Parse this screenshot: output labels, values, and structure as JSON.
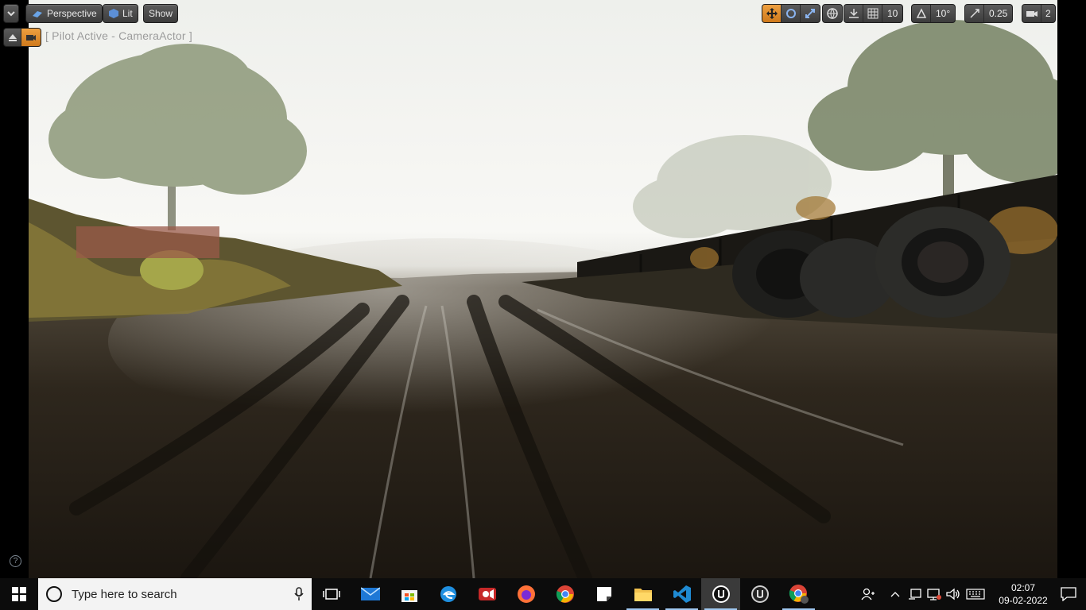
{
  "viewport": {
    "toolbar": {
      "menu_icon": "chevron-down-icon",
      "perspective_label": "Perspective",
      "lit_label": "Lit",
      "show_label": "Show",
      "grid_snap_value": "10",
      "rotation_snap_value": "10°",
      "scale_snap_value": "0.25",
      "camera_speed_value": "2",
      "active_color": "#e5952e"
    },
    "pilot_label": "[ Pilot Active - CameraActor ]",
    "help_icon": "?"
  },
  "taskbar": {
    "search_placeholder": "Type here to search",
    "apps": [
      {
        "name": "task-view-icon"
      },
      {
        "name": "mail-icon"
      },
      {
        "name": "store-icon"
      },
      {
        "name": "edge-icon"
      },
      {
        "name": "screen-recorder-icon"
      },
      {
        "name": "firefox-icon"
      },
      {
        "name": "chrome-icon"
      },
      {
        "name": "sticky-notes-icon"
      },
      {
        "name": "file-explorer-icon"
      },
      {
        "name": "vscode-icon"
      },
      {
        "name": "unreal-editor-icon"
      },
      {
        "name": "unreal-launcher-icon"
      },
      {
        "name": "chrome-profile-icon"
      }
    ],
    "clock": {
      "time": "02:07",
      "date": "09-02-2022"
    }
  }
}
